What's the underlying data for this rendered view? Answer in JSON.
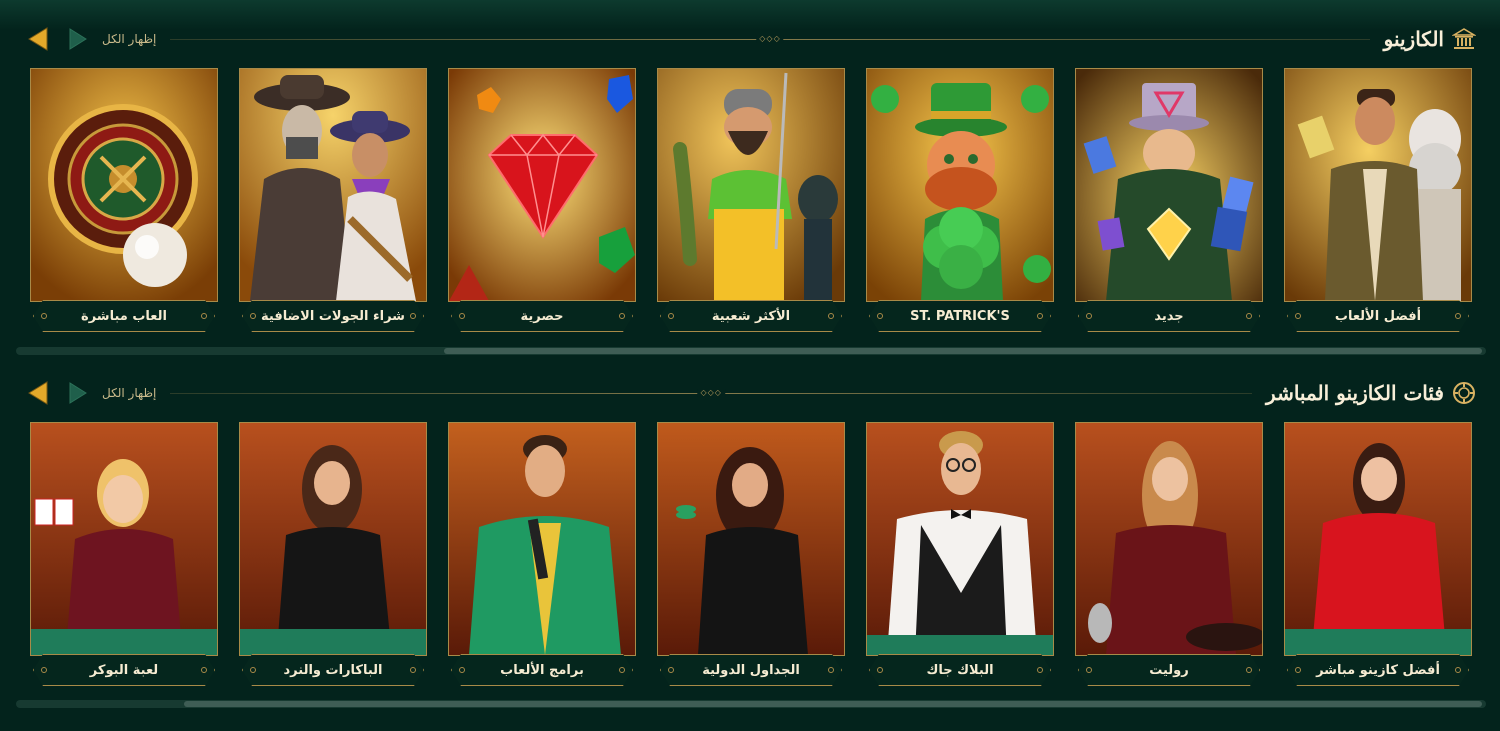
{
  "sections": [
    {
      "title": "الكازينو",
      "icon": "bank-building-icon",
      "show_all": "إظهار الكل",
      "cards": [
        {
          "label": "أفضل الألعاب",
          "art": "explorer-and-zeus-art"
        },
        {
          "label": "جديد",
          "art": "magician-cards-art"
        },
        {
          "label": "ST. PATRICK'S",
          "art": "leprechaun-clover-art"
        },
        {
          "label": "الأكثر شعبية",
          "art": "fisherman-art"
        },
        {
          "label": "حصرية",
          "art": "ruby-gem-art"
        },
        {
          "label": "شراء الجولات الاضافية",
          "art": "cowgirls-art"
        },
        {
          "label": "العاب مباشرة",
          "art": "roulette-wheel-art"
        }
      ],
      "scroll": {
        "position": 0.32,
        "visible": 0.71
      }
    },
    {
      "title": "فئات الكازينو المباشر",
      "icon": "casino-chip-icon",
      "show_all": "إظهار الكل",
      "cards": [
        {
          "label": "أفضل كازينو مباشر",
          "art": "dealer-red-dress-art"
        },
        {
          "label": "روليت",
          "art": "dealer-maroon-roulette-art"
        },
        {
          "label": "البلاك جاك",
          "art": "dealer-vest-bowtie-art"
        },
        {
          "label": "الجداول الدولية",
          "art": "dealer-black-chips-art"
        },
        {
          "label": "برامج الألعاب",
          "art": "host-green-suit-art"
        },
        {
          "label": "الباكارات والنرد",
          "art": "dealer-black-dress-art"
        },
        {
          "label": "لعبة البوكر",
          "art": "dealer-cards-art"
        }
      ],
      "scroll": {
        "position": 0.12,
        "visible": 0.85
      }
    }
  ],
  "colors": {
    "background": "#03231c",
    "gold": "#a88a48",
    "accent_arrow": "#e4a92a",
    "inactive_arrow": "#1f5f4b"
  }
}
